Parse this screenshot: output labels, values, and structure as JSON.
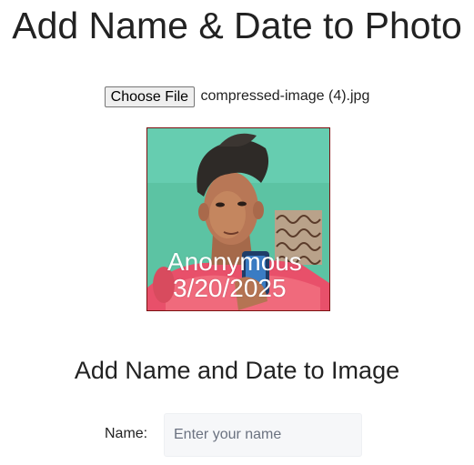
{
  "header": {
    "title": "Add Name & Date to Photo"
  },
  "file_picker": {
    "button_label": "Choose File",
    "file_name": "compressed-image (4).jpg"
  },
  "photo": {
    "overlay_name": "Anonymous",
    "overlay_date": "3/20/2025",
    "frame_border_color": "#7a1010"
  },
  "form": {
    "section_title": "Add Name and Date to Image",
    "name_label": "Name:",
    "name_placeholder": "Enter your name",
    "name_value": ""
  }
}
